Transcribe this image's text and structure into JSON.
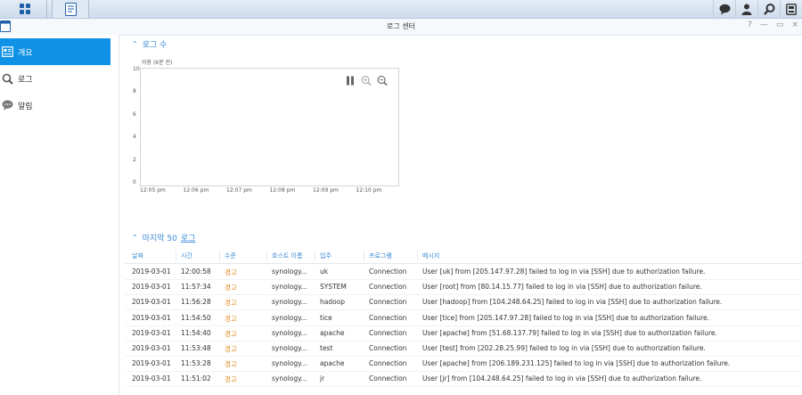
{
  "taskbar": {
    "main_menu_icon": "grid-icon",
    "log_center_icon": "log-center-app-icon",
    "right_icons": [
      "chat-icon",
      "user-icon",
      "search-icon",
      "widgets-icon"
    ]
  },
  "window": {
    "title": "로그 센터",
    "controls": {
      "help": "?",
      "minimize": "—",
      "maximize": "▭",
      "close": "×"
    }
  },
  "sidebar": {
    "items": [
      {
        "label": "개요",
        "icon": "overview-icon",
        "active": true
      },
      {
        "label": "로그",
        "icon": "search-icon",
        "active": false
      },
      {
        "label": "알림",
        "icon": "chat-bubble-icon",
        "active": false
      }
    ]
  },
  "log_count": {
    "section_title": "로그 수",
    "chart_data": {
      "type": "line",
      "ylabel": "이용 (6분 전)",
      "yticks": [
        "10",
        "8",
        "6",
        "4",
        "2",
        "0"
      ],
      "ylim": [
        0,
        10
      ],
      "categories": [
        "12:05 pm",
        "12:06 pm",
        "12:07 pm",
        "12:08 pm",
        "12:09 pm",
        "12:10 pm"
      ],
      "series": [],
      "grid": false,
      "tools": [
        "pause-icon",
        "zoom-in-icon",
        "zoom-out-icon"
      ]
    }
  },
  "recent_logs": {
    "title_prefix": "마지막 50",
    "title_link": "로그",
    "columns": [
      "날짜",
      "시간",
      "수준",
      "호스트 이름",
      "업주",
      "프로그램",
      "메시지"
    ],
    "rows": [
      [
        "2019-03-01",
        "12:00:58",
        "경고",
        "synology...",
        "uk",
        "Connection",
        "User [uk] from [205.147.97.28] failed to log in via [SSH] due to authorization failure."
      ],
      [
        "2019-03-01",
        "11:57:34",
        "경고",
        "synology...",
        "SYSTEM",
        "Connection",
        "User [root] from [80.14.15.77] failed to log in via [SSH] due to authorization failure."
      ],
      [
        "2019-03-01",
        "11:56:28",
        "경고",
        "synology...",
        "hadoop",
        "Connection",
        "User [hadoop] from [104.248.64.25] failed to log in via [SSH] due to authorization failure."
      ],
      [
        "2019-03-01",
        "11:54:50",
        "경고",
        "synology...",
        "tice",
        "Connection",
        "User [tice] from [205.147.97.28] failed to log in via [SSH] due to authorization failure."
      ],
      [
        "2019-03-01",
        "11:54:40",
        "경고",
        "synology...",
        "apache",
        "Connection",
        "User [apache] from [51.68.137.79] failed to log in via [SSH] due to authorization failure."
      ],
      [
        "2019-03-01",
        "11:53:48",
        "경고",
        "synology...",
        "test",
        "Connection",
        "User [test] from [202.28.25.99] failed to log in via [SSH] due to authorization failure."
      ],
      [
        "2019-03-01",
        "11:53:28",
        "경고",
        "synology...",
        "apache",
        "Connection",
        "User [apache] from [206.189.231.125] failed to log in via [SSH] due to authorization failure."
      ],
      [
        "2019-03-01",
        "11:51:02",
        "경고",
        "synology...",
        "jr",
        "Connection",
        "User [jr] from [104.248.64.25] failed to log in via [SSH] due to authorization failure."
      ]
    ]
  },
  "colors": {
    "accent": "#0f91e6",
    "link": "#3a8ad6",
    "warning": "#e08a1e"
  }
}
